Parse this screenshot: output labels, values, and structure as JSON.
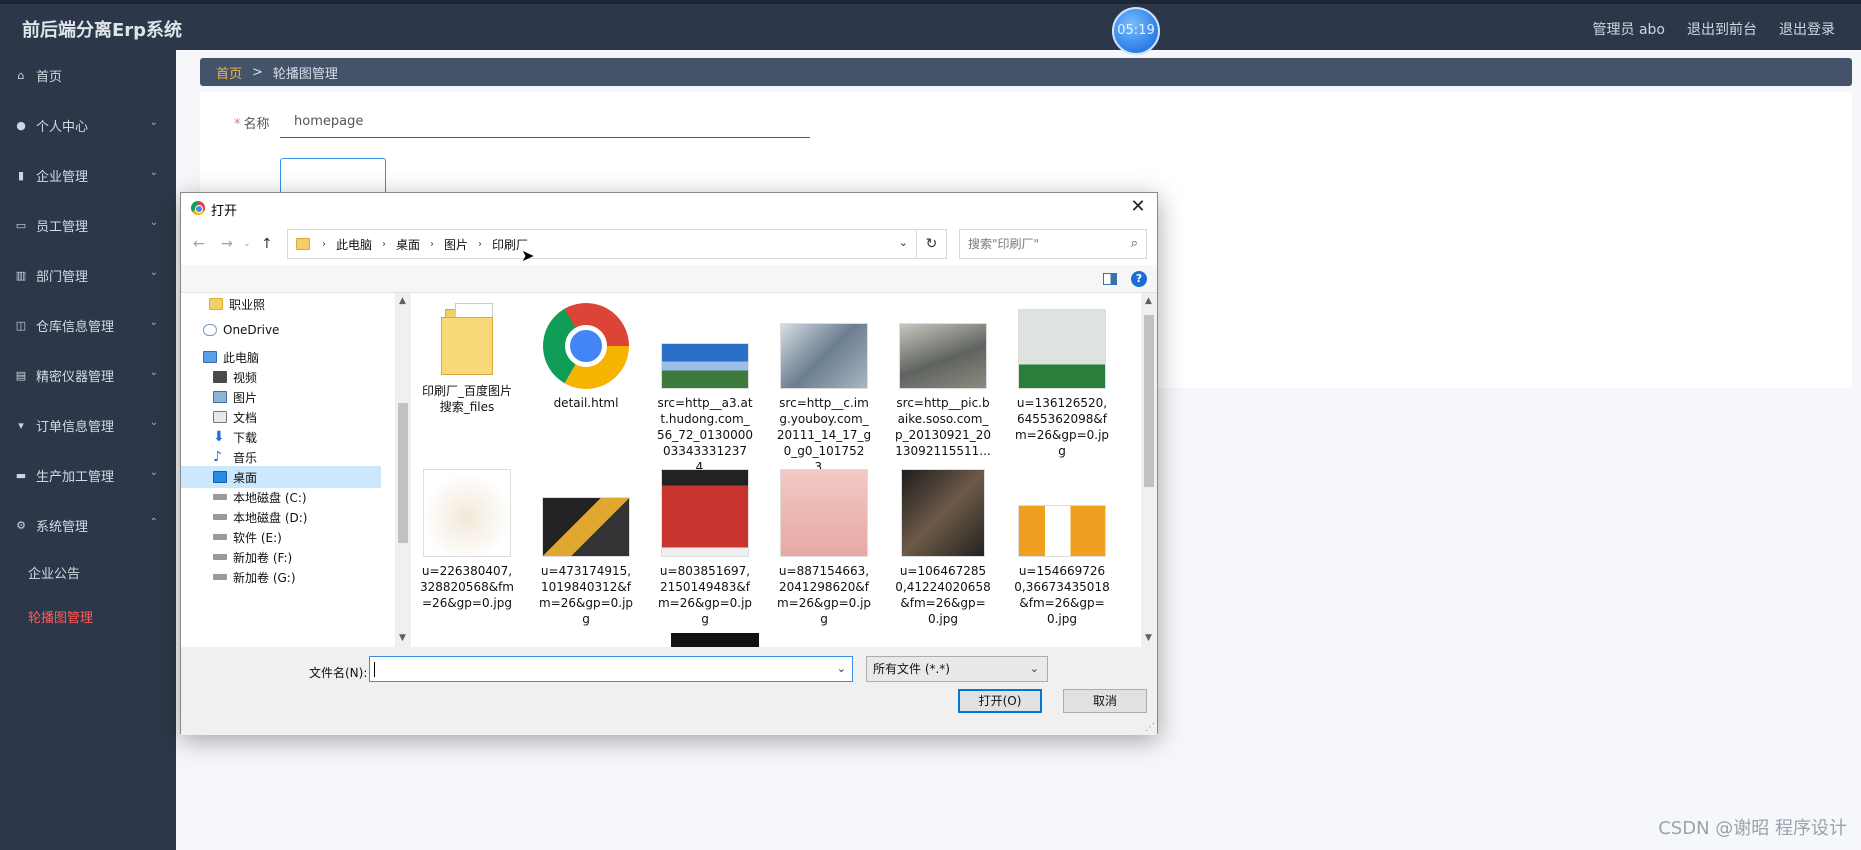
{
  "header": {
    "app_title": "前后端分离Erp系统",
    "clock": "05:19",
    "admin_label": "管理员 abo",
    "to_front": "退出到前台",
    "logout": "退出登录"
  },
  "sidebar": {
    "items": [
      {
        "label": "首页",
        "icon": "home-icon",
        "chevron": ""
      },
      {
        "label": "个人中心",
        "icon": "user-icon",
        "chevron": "⌄"
      },
      {
        "label": "企业管理",
        "icon": "building-icon",
        "chevron": "⌄"
      },
      {
        "label": "员工管理",
        "icon": "id-card-icon",
        "chevron": "⌄"
      },
      {
        "label": "部门管理",
        "icon": "bar-chart-icon",
        "chevron": "⌄"
      },
      {
        "label": "仓库信息管理",
        "icon": "warehouse-icon",
        "chevron": "⌄"
      },
      {
        "label": "精密仪器管理",
        "icon": "instrument-icon",
        "chevron": "⌄"
      },
      {
        "label": "订单信息管理",
        "icon": "order-icon",
        "chevron": "⌄"
      },
      {
        "label": "生产加工管理",
        "icon": "factory-icon",
        "chevron": "⌄"
      },
      {
        "label": "系统管理",
        "icon": "settings-icon",
        "chevron": "⌃"
      }
    ],
    "sub_items": [
      {
        "label": "企业公告",
        "active": false
      },
      {
        "label": "轮播图管理",
        "active": true
      }
    ]
  },
  "breadcrumb": {
    "home": "首页",
    "separator": ">",
    "current": "轮播图管理"
  },
  "form": {
    "name_required": "*",
    "name_label": "名称",
    "name_value": "homepage"
  },
  "dialog": {
    "title": "打开",
    "close": "✕",
    "path": [
      "此电脑",
      "桌面",
      "图片",
      "印刷厂"
    ],
    "search_placeholder": "搜索\"印刷厂\"",
    "tree": [
      {
        "label": "职业照",
        "icon": "folder-icon"
      },
      {
        "label": "OneDrive",
        "icon": "cloud-icon"
      },
      {
        "label": "此电脑",
        "icon": "computer-icon"
      },
      {
        "label": "视频",
        "icon": "video-icon"
      },
      {
        "label": "图片",
        "icon": "picture-icon"
      },
      {
        "label": "文档",
        "icon": "document-icon"
      },
      {
        "label": "下载",
        "icon": "download-icon"
      },
      {
        "label": "音乐",
        "icon": "music-icon"
      },
      {
        "label": "桌面",
        "icon": "desktop-icon"
      },
      {
        "label": "本地磁盘 (C:)",
        "icon": "drive-icon"
      },
      {
        "label": "本地磁盘 (D:)",
        "icon": "drive-icon"
      },
      {
        "label": "软件 (E:)",
        "icon": "drive-icon"
      },
      {
        "label": "新加卷 (F:)",
        "icon": "drive-icon"
      },
      {
        "label": "新加卷 (G:)",
        "icon": "drive-icon"
      }
    ],
    "files": [
      {
        "name": "印刷厂_百度图片搜索_files",
        "kind": "folder"
      },
      {
        "name": "detail.html",
        "kind": "chrome"
      },
      {
        "name": "src=http__a3.att.hudong.com_56_72_0130000033433312374...",
        "kind": "photo-building"
      },
      {
        "name": "src=http__c.img.youboy.com_20111_14_17_g0_g0_1017523...",
        "kind": "photo-press"
      },
      {
        "name": "src=http__pic.baike.soso.com_p_20130921_2013092115511...",
        "kind": "photo-machine"
      },
      {
        "name": "u=136126520,6455362098&fm=26&gp=0.jpg",
        "kind": "photo-label"
      },
      {
        "name": "u=226380407,328820568&fm=26&gp=0.jpg",
        "kind": "photo-cups"
      },
      {
        "name": "u=473174915,1019840312&fm=26&gp=0.jpg",
        "kind": "photo-brochure"
      },
      {
        "name": "u=803851697,2150149483&fm=26&gp=0.jpg",
        "kind": "photo-book"
      },
      {
        "name": "u=887154663,2041298620&fm=26&gp=0.jpg",
        "kind": "photo-bag"
      },
      {
        "name": "u=1064672850,41224020658&fm=26&gp=0.jpg",
        "kind": "photo-magazine"
      },
      {
        "name": "u=1546697260,36673435018&fm=26&gp=0.jpg",
        "kind": "photo-fold"
      }
    ],
    "filename_label": "文件名(N):",
    "filename_value": "",
    "filetype": "所有文件 (*.*)",
    "open_button": "打开(O)",
    "cancel_button": "取消"
  },
  "watermark": "CSDN @谢昭  程序设计",
  "colors": {
    "sidebar_bg": "#2c3849",
    "breadcrumb_bg": "#44526a",
    "active_menu": "#ff5a5a",
    "breadcrumb_home": "#f1b24a",
    "clock_blue": "#2a7ee6"
  }
}
